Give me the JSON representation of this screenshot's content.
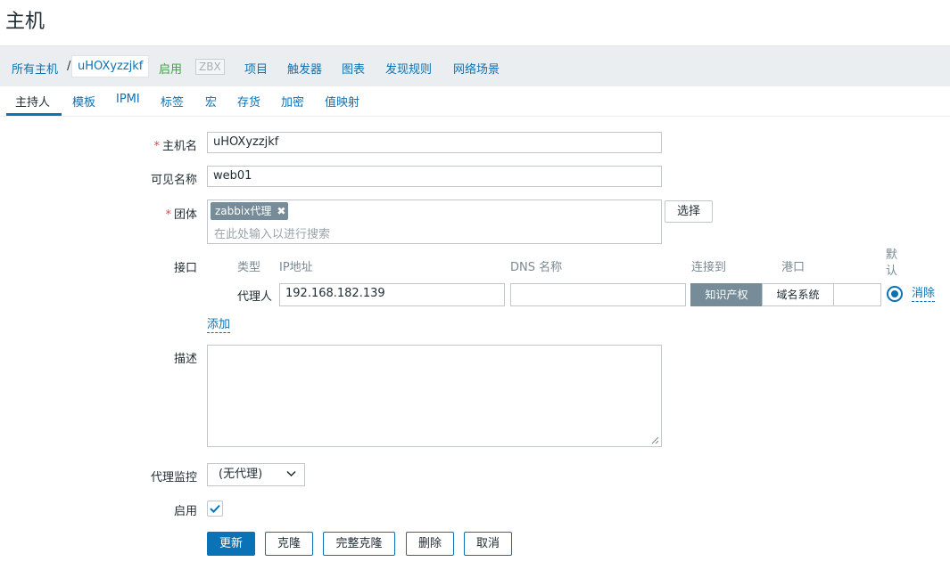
{
  "page": {
    "title": "主机"
  },
  "breadcrumb": {
    "all_hosts": "所有主机",
    "separator": "/",
    "host": "uHOXyzzjkf",
    "status": "启用",
    "zbx": "ZBX",
    "links": [
      "项目",
      "触发器",
      "图表",
      "发现规则",
      "网络场景"
    ]
  },
  "tabs": [
    "主持人",
    "模板",
    "IPMI",
    "标签",
    "宏",
    "存货",
    "加密",
    "值映射"
  ],
  "form": {
    "hostname": {
      "label": "主机名",
      "value": "uHOXyzzjkf"
    },
    "visible_name": {
      "label": "可见名称",
      "value": "web01"
    },
    "groups": {
      "label": "团体",
      "chips": [
        "zabbix代理"
      ],
      "placeholder": "在此处输入以进行搜索",
      "select_button": "选择"
    },
    "interfaces": {
      "label": "接口",
      "headers": {
        "type": "类型",
        "ip": "IP地址",
        "dns": "DNS 名称",
        "connect": "连接到",
        "port": "港口",
        "default": "默认"
      },
      "row": {
        "type": "代理人",
        "ip": "192.168.182.139",
        "dns": "",
        "connect_ip": "知识产权",
        "connect_dns": "域名系统",
        "port": "",
        "remove": "消除"
      },
      "add": "添加"
    },
    "description": {
      "label": "描述",
      "value": ""
    },
    "proxy": {
      "label": "代理监控",
      "value": "(无代理)"
    },
    "enabled": {
      "label": "启用",
      "checked": true
    }
  },
  "actions": {
    "update": "更新",
    "clone": "克隆",
    "full_clone": "完整克隆",
    "delete": "删除",
    "cancel": "取消"
  },
  "colors": {
    "accent": "#0b72b5",
    "enabled": "#429e47",
    "required": "#d64e4e",
    "chip": "#768d99"
  }
}
